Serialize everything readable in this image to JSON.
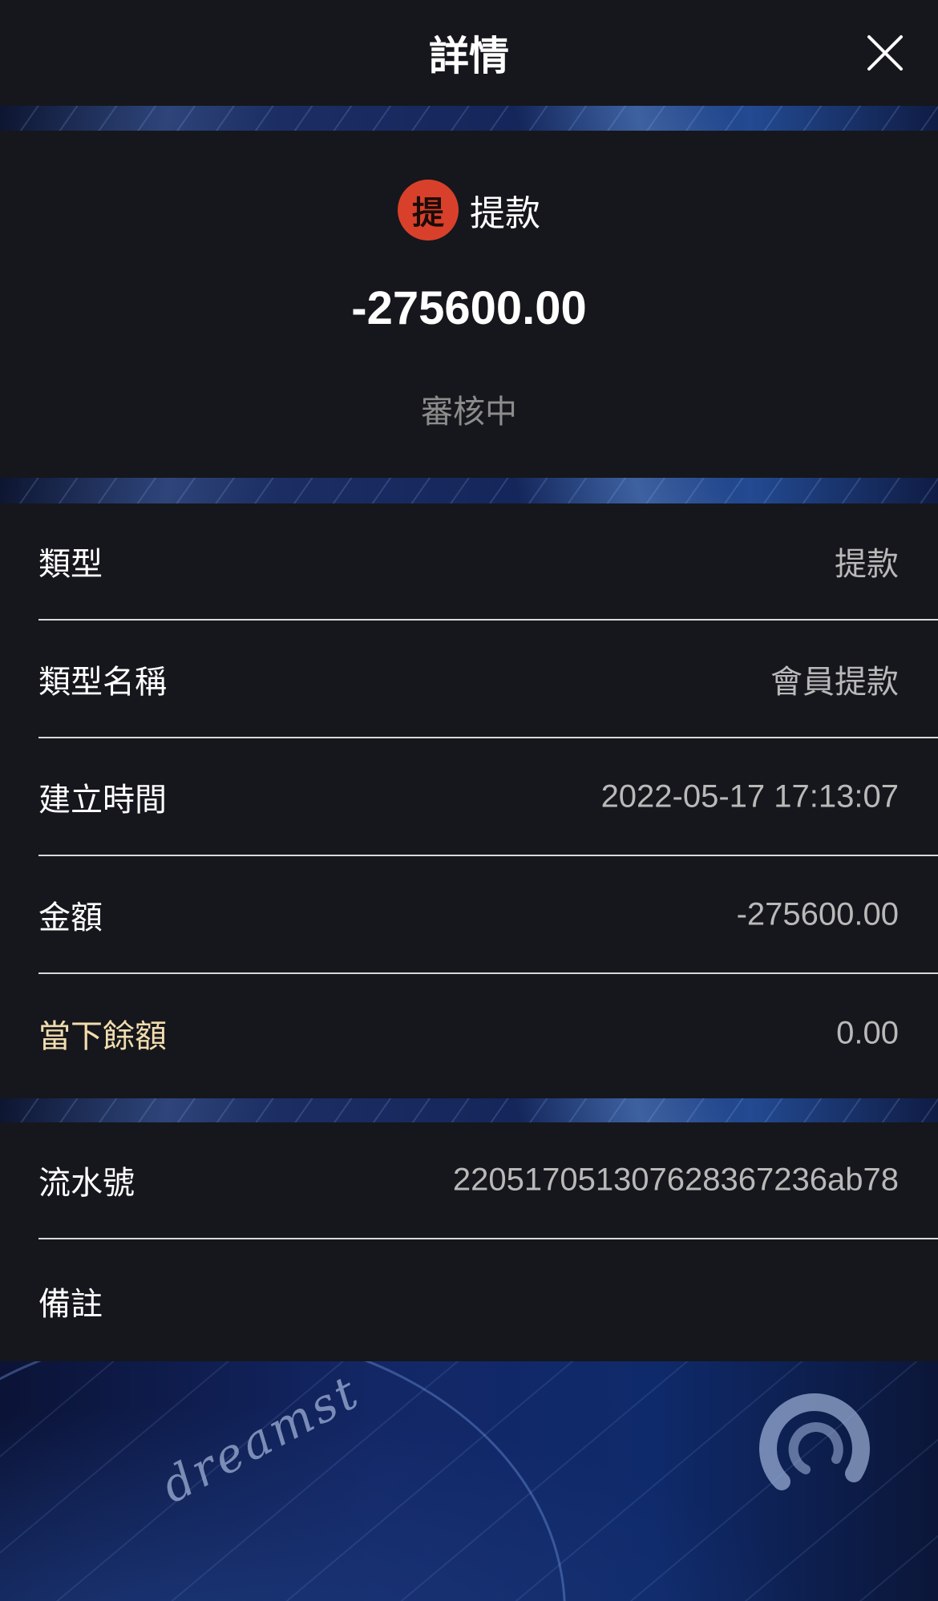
{
  "header": {
    "title": "詳情",
    "close_icon": "close-icon"
  },
  "summary": {
    "type_badge": "提",
    "type_label": "提款",
    "amount": "-275600.00",
    "status": "審核中"
  },
  "details": [
    {
      "label": "類型",
      "value": "提款"
    },
    {
      "label": "類型名稱",
      "value": "會員提款"
    },
    {
      "label": "建立時間",
      "value": "2022-05-17 17:13:07"
    },
    {
      "label": "金額",
      "value": "-275600.00"
    },
    {
      "label": "當下餘額",
      "value": "0.00"
    }
  ],
  "extra": [
    {
      "label": "流水號",
      "value": "220517051307628367236ab78"
    },
    {
      "label": "備註",
      "value": ""
    }
  ],
  "decor": {
    "brand_text": "dreamst"
  },
  "colors": {
    "background": "#16171c",
    "badge": "#d9402b",
    "value_text": "#b9b9b9",
    "highlight_label": "#f1dcae"
  }
}
